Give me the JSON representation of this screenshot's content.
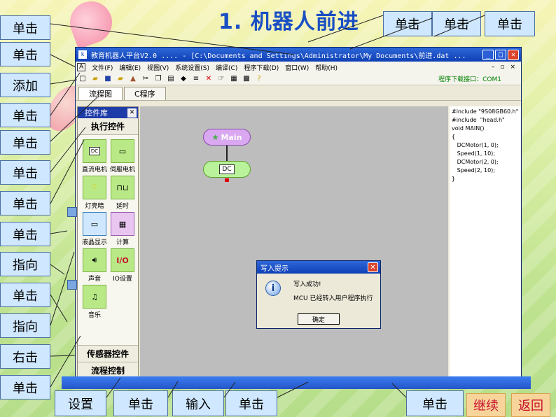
{
  "slide": {
    "title": "1. 机器人前进",
    "colors": {
      "title": "#1a4fc4",
      "callout_bg": "#cfe7ff",
      "nav_bg": "#f7d49a",
      "nav_text": "#c8102e"
    }
  },
  "callouts": {
    "left": [
      "单击",
      "单击",
      "添加",
      "单击",
      "单击",
      "单击",
      "单击",
      "单击",
      "指向",
      "单击",
      "指向",
      "右击",
      "单击"
    ],
    "top": [
      "单击",
      "单击",
      "单击"
    ],
    "bottom": [
      "设置",
      "单击",
      "输入",
      "单击",
      "单击"
    ]
  },
  "nav": {
    "continue": "继续",
    "back": "返回"
  },
  "window": {
    "app_icon": "k",
    "title": "教育机器人平台V2.0 .... - [C:\\Documents and Settings\\Administrator\\My Documents\\前进.dat ...",
    "menu": [
      "文件(F)",
      "编辑(E)",
      "视图(V)",
      "系统设置(S)",
      "编译(C)",
      "程序下载(D)",
      "窗口(W)",
      "帮助(H)"
    ],
    "download_port": "程序下载接口：COM1",
    "tabs": [
      "流程图",
      "C程序"
    ],
    "palette": {
      "title": "控件库",
      "section_exec": "执行控件",
      "controls": [
        "直流电机",
        "伺服电机",
        "灯亮暗",
        "延时",
        "液晶显示",
        "计算",
        "声音",
        "IO设置",
        "音乐"
      ],
      "section_sensor": "传感器控件",
      "section_flow": "流程控制"
    },
    "flow": {
      "main_label": "Main",
      "dc_label": "DC"
    },
    "code": "#include \"9S08GB60.h\"\n#include  \"head.h\"\nvoid MAIN()\n{\n   DCMotor(1, 0);\n   Speed(1, 10);\n   DCMotor(2, 0);\n   Speed(2, 10);\n}",
    "dialog": {
      "title": "写入提示",
      "line1": "写入成功!",
      "line2": "MCU 已经转入用户程序执行",
      "ok": "确定"
    }
  }
}
